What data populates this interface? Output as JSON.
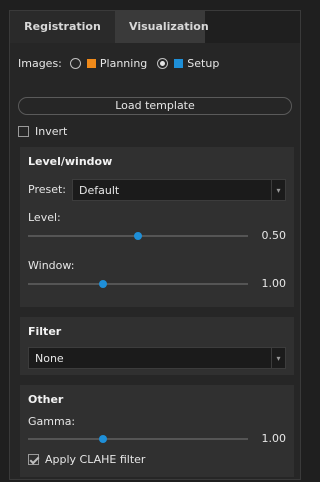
{
  "tabs": [
    {
      "label": "Registration"
    },
    {
      "label": "Visualization"
    }
  ],
  "images": {
    "label": "Images:",
    "options": [
      {
        "label": "Planning",
        "color": "#f08a1a",
        "selected": false
      },
      {
        "label": "Setup",
        "color": "#1e8fd8",
        "selected": true
      }
    ]
  },
  "load_template_label": "Load template",
  "invert": {
    "label": "Invert",
    "checked": false
  },
  "level_window": {
    "title": "Level/window",
    "preset_label": "Preset:",
    "preset_value": "Default",
    "level_label": "Level:",
    "level_value": "0.50",
    "level_fraction": 0.5,
    "window_label": "Window:",
    "window_value": "1.00",
    "window_fraction": 0.34
  },
  "filter": {
    "title": "Filter",
    "value": "None"
  },
  "other": {
    "title": "Other",
    "gamma_label": "Gamma:",
    "gamma_value": "1.00",
    "gamma_fraction": 0.34,
    "clahe_label": "Apply CLAHE filter",
    "clahe_checked": true
  }
}
